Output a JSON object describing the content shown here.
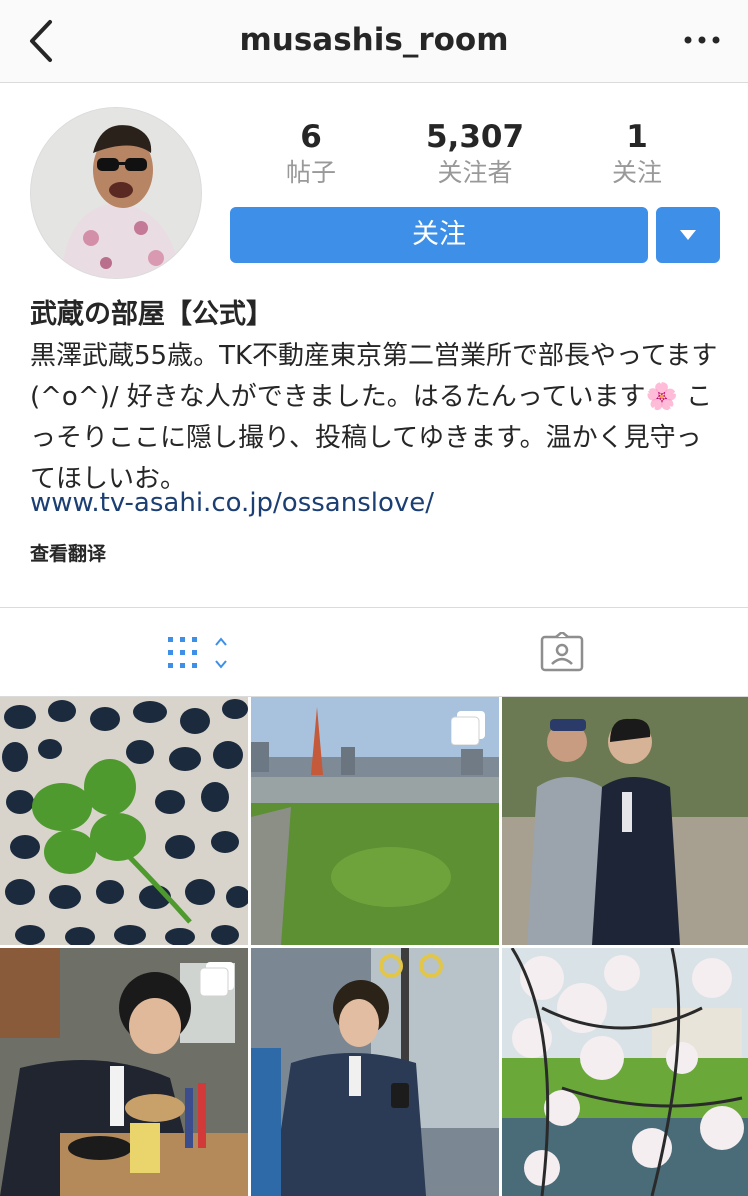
{
  "header": {
    "username": "musashis_room",
    "back_icon": "chevron-left-icon",
    "more_icon": "more-horizontal-icon"
  },
  "profile": {
    "stats": [
      {
        "value": "6",
        "label": "帖子"
      },
      {
        "value": "5,307",
        "label": "关注者"
      },
      {
        "value": "1",
        "label": "关注"
      }
    ],
    "follow_label": "关注",
    "display_name": "武蔵の部屋【公式】",
    "bio": "黒澤武蔵55歳。TK不動産東京第二営業所で部長やってます(^o^)/ 好きな人ができました。はるたんっています🌸 こっそりここに隠し撮り、投稿してゆきます。温かく見守ってほしいお。",
    "link": "www.tv-asahi.co.jp/ossanslove/",
    "translate_label": "查看翻译"
  },
  "tabs": [
    {
      "name": "grid",
      "icon": "grid-icon"
    },
    {
      "name": "tagged",
      "icon": "tagged-person-icon"
    }
  ],
  "colors": {
    "accent": "#3d8fe8",
    "link": "#1c3f73",
    "muted": "#999999"
  },
  "grid": [
    {
      "description_icon": "photo-clover-stones",
      "multi": false
    },
    {
      "description_icon": "photo-rooftop-tokyo-tower",
      "multi": true
    },
    {
      "description_icon": "photo-two-men-walking",
      "multi": false
    },
    {
      "description_icon": "photo-man-eating-office",
      "multi": true
    },
    {
      "description_icon": "photo-man-on-bus",
      "multi": false
    },
    {
      "description_icon": "photo-cherry-blossoms-river",
      "multi": false
    }
  ]
}
